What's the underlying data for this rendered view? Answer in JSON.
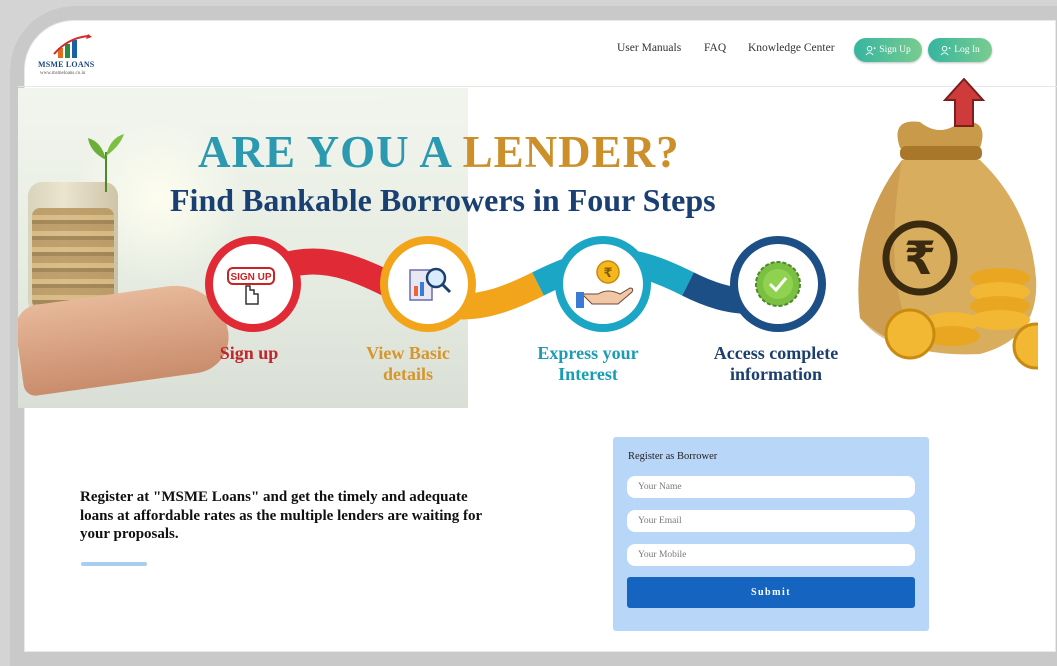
{
  "brand": {
    "name": "MSME LOANS",
    "tagline": "www.msmeloans.co.in"
  },
  "nav": {
    "links": [
      "User Manuals",
      "FAQ",
      "Knowledge Center"
    ],
    "signup_label": "Sign Up",
    "login_label": "Log In"
  },
  "banner": {
    "title_part1": "ARE YOU A",
    "title_part2": "LENDER?",
    "subtitle": "Find Bankable Borrowers in Four Steps",
    "steps": [
      {
        "label": "Sign up",
        "icon": "signup-hand-icon",
        "badge": "SIGN UP"
      },
      {
        "label": "View Basic details",
        "icon": "document-magnifier-icon"
      },
      {
        "label": "Express your Interest",
        "icon": "rupee-hand-icon",
        "symbol": "₹"
      },
      {
        "label": "Access complete information",
        "icon": "check-badge-icon"
      }
    ],
    "bag_symbol": "₹",
    "colors": {
      "step1": "#e02a35",
      "step2": "#f2a51a",
      "step3": "#1aa6c4",
      "step4": "#1c4f86"
    }
  },
  "promo": {
    "text": "Register at \"MSME Loans\" and get the timely and adequate loans at affordable rates as the multiple lenders are waiting for your proposals."
  },
  "register": {
    "title": "Register as Borrower",
    "name_placeholder": "Your Name",
    "email_placeholder": "Your Email",
    "mobile_placeholder": "Your Mobile",
    "submit_label": "Submit"
  },
  "annotation": {
    "icon": "red-up-arrow-icon"
  }
}
